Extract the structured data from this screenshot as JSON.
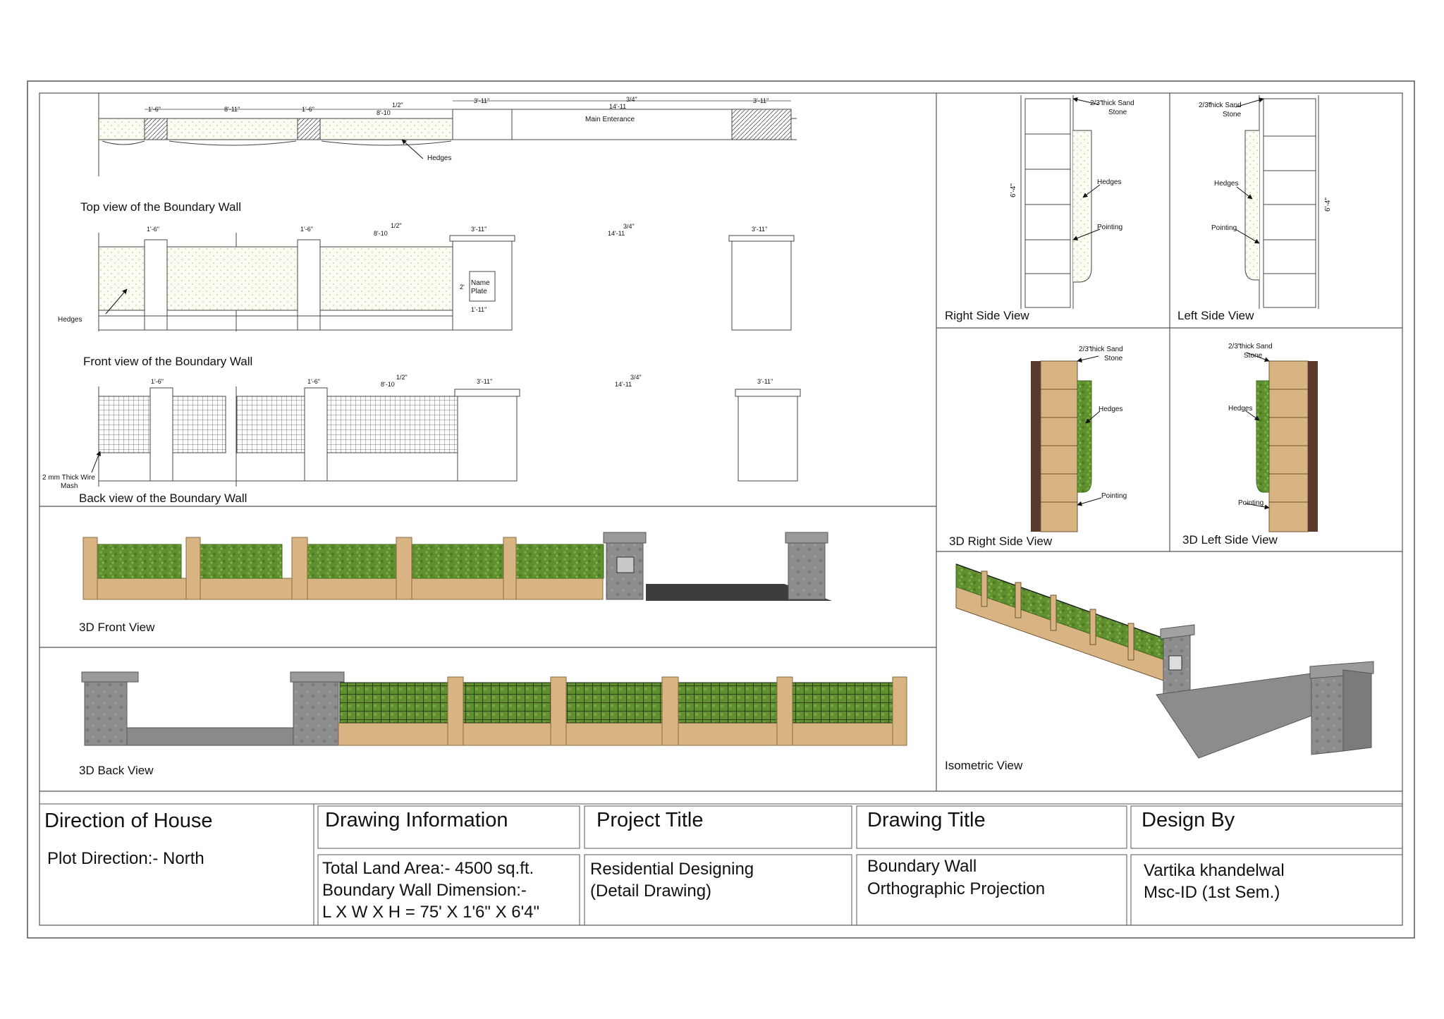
{
  "sheet": {
    "views": {
      "top": "Top view of the Boundary Wall",
      "front": "Front view of the Boundary Wall",
      "back": "Back view of the Boundary Wall",
      "front3d": "3D Front View",
      "back3d": "3D Back View",
      "right": "Right Side View",
      "left": "Left Side View",
      "right3d": "3D Right Side View",
      "left3d": "3D Left Side View",
      "iso": "Isometric View"
    },
    "annotations": {
      "hedges": "Hedges",
      "main_entrance": "Main Enterance",
      "name_plate_1": "Name",
      "name_plate_2": "Plate",
      "wire_mesh_1": "2 mm Thick Wire",
      "wire_mesh_2": "Mash",
      "sand_stone_1": "thick Sand",
      "sand_stone_2": "Stone",
      "stone_fraction": "2/3\"",
      "pointing": "Pointing",
      "height": "6'-4\""
    },
    "dimensions": {
      "d1": "1'-6\"",
      "d2": "8'-11\"",
      "d3": "8'-10",
      "d3_frac": "1/2\"",
      "d4": "3'-11\"",
      "d5": "14'-11",
      "d5_frac": "3/4\"",
      "d6": "1'-11\"",
      "d7": "2'"
    }
  },
  "title_block": {
    "direction": {
      "heading": "Direction of House",
      "value": "Plot Direction:- North"
    },
    "drawing_info": {
      "heading": "Drawing Information",
      "line1": "Total Land Area:- 4500 sq.ft.",
      "line2": "Boundary Wall Dimension:-",
      "line3": "L X W X H = 75' X 1'6\" X 6'4\""
    },
    "project": {
      "heading": "Project Title",
      "line1": "Residential Designing",
      "line2": "(Detail Drawing)"
    },
    "drawing_title": {
      "heading": "Drawing Title",
      "line1": "Boundary Wall",
      "line2": "Orthographic Projection"
    },
    "design_by": {
      "heading": "Design By",
      "line1": "Vartika khandelwal",
      "line2": "Msc-ID (1st Sem.)"
    }
  },
  "colors": {
    "hedge": "#5f8f2e",
    "hedge_dark": "#3f6a1f",
    "sandstone": "#d9b483",
    "pillar_grey": "#8d8d8d",
    "line": "#444444"
  }
}
